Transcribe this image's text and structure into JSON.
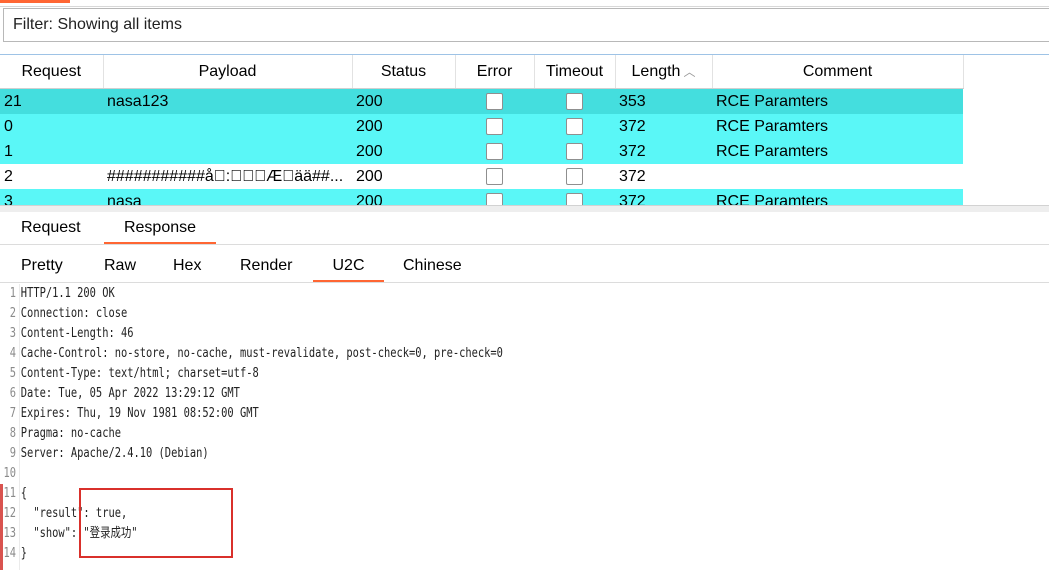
{
  "filter": {
    "text": "Filter: Showing all items"
  },
  "table": {
    "columns": [
      "Request",
      "Payload",
      "Status",
      "Error",
      "Timeout",
      "Length",
      "Comment"
    ],
    "sort_indicator": "^",
    "rows": [
      {
        "request": "21",
        "payload": "nasa123",
        "status": "200",
        "error": false,
        "timeout": false,
        "length": "353",
        "comment": "RCE Paramters",
        "style": "selected"
      },
      {
        "request": "0",
        "payload": "",
        "status": "200",
        "error": false,
        "timeout": false,
        "length": "372",
        "comment": "RCE Paramters",
        "style": "cyan"
      },
      {
        "request": "1",
        "payload": "",
        "status": "200",
        "error": false,
        "timeout": false,
        "length": "372",
        "comment": "RCE Paramters",
        "style": "cyan"
      },
      {
        "request": "2",
        "payload": "###########å\u0000:\u0000\u0000\u0000Æ\u0000ää##...",
        "status": "200",
        "error": false,
        "timeout": false,
        "length": "372",
        "comment": "",
        "style": "white"
      },
      {
        "request": "3",
        "payload": "nasa",
        "status": "200",
        "error": false,
        "timeout": false,
        "length": "372",
        "comment": "RCE Paramters",
        "style": "cyan"
      }
    ]
  },
  "tabs_primary": {
    "request": "Request",
    "response": "Response"
  },
  "tabs_secondary": {
    "pretty": "Pretty",
    "raw": "Raw",
    "hex": "Hex",
    "render": "Render",
    "u2c": "U2C",
    "chinese": "Chinese"
  },
  "colors": {
    "accent": "#ff6633",
    "selected_row": "#44dede",
    "cyan_row": "#5af7f7",
    "highlight": "#d9302b"
  },
  "editor": {
    "lines": [
      {
        "n": "1",
        "text": "HTTP/1.1 200 OK"
      },
      {
        "n": "2",
        "text": "Connection: close"
      },
      {
        "n": "3",
        "text": "Content-Length: 46"
      },
      {
        "n": "4",
        "text": "Cache-Control: no-store, no-cache, must-revalidate, post-check=0, pre-check=0"
      },
      {
        "n": "5",
        "text": "Content-Type: text/html; charset=utf-8"
      },
      {
        "n": "6",
        "text": "Date: Tue, 05 Apr 2022 13:29:12 GMT"
      },
      {
        "n": "7",
        "text": "Expires: Thu, 19 Nov 1981 08:52:00 GMT"
      },
      {
        "n": "8",
        "text": "Pragma: no-cache"
      },
      {
        "n": "9",
        "text": "Server: Apache/2.4.10 (Debian)"
      },
      {
        "n": "10",
        "text": ""
      },
      {
        "n": "11",
        "text": "{"
      },
      {
        "n": "12",
        "text": "  \"result\": true,"
      },
      {
        "n": "13",
        "text": "  \"show\": \"登录成功\""
      },
      {
        "n": "14",
        "text": "}"
      }
    ]
  }
}
